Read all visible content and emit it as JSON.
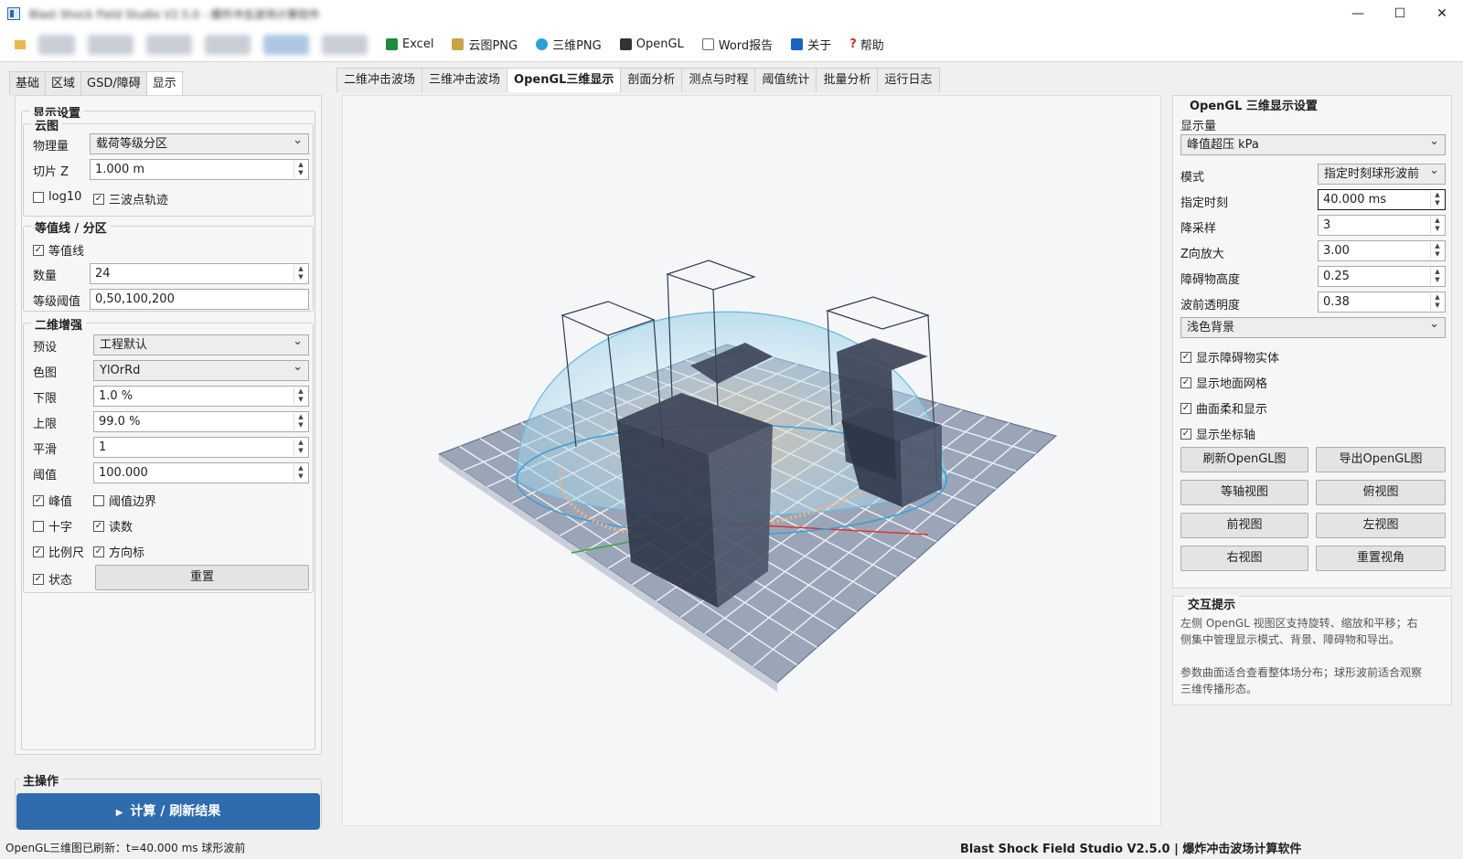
{
  "window": {
    "title": "Blast Shock Field Studio V2.5.0 - 爆炸冲击波场计算软件",
    "minimize": "—",
    "maximize": "☐",
    "close": "✕"
  },
  "toolbar": {
    "items": [
      "Excel",
      "云图PNG",
      "三维PNG",
      "OpenGL",
      "Word报告",
      "关于",
      "帮助"
    ]
  },
  "left_tabs": [
    "基础",
    "区域",
    "GSD/障碍",
    "显示"
  ],
  "display": {
    "title": "显示设置",
    "cloud": {
      "title": "云图",
      "quantity_label": "物理量",
      "quantity_value": "载荷等级分区",
      "slice_label": "切片 Z",
      "slice_value": "1.000 m",
      "log10": "log10",
      "track": "三波点轨迹"
    },
    "contour": {
      "title": "等值线 / 分区",
      "enable": "等值线",
      "count_label": "数量",
      "count_value": "24",
      "levels_label": "等级阈值",
      "levels_value": "0,50,100,200"
    },
    "enhance": {
      "title": "二维增强",
      "preset_label": "预设",
      "preset_value": "工程默认",
      "cmap_label": "色图",
      "cmap_value": "YlOrRd",
      "low_label": "下限",
      "low_value": "1.0 %",
      "high_label": "上限",
      "high_value": "99.0 %",
      "smooth_label": "平滑",
      "smooth_value": "1",
      "thresh_label": "阈值",
      "thresh_value": "100.000",
      "peak": "峰值",
      "thresh_edge": "阈值边界",
      "cross": "十字",
      "readout": "读数",
      "scalebar": "比例尺",
      "compass": "方向标",
      "status": "状态",
      "reset": "重置"
    }
  },
  "main_ops": {
    "title": "主操作",
    "compute": "计算 / 刷新结果"
  },
  "main_tabs": [
    "二维冲击波场",
    "三维冲击波场",
    "OpenGL三维显示",
    "剖面分析",
    "测点与时程",
    "阈值统计",
    "批量分析",
    "运行日志"
  ],
  "opengl": {
    "title": "OpenGL 三维显示设置",
    "qty_label": "显示量",
    "qty_value": "峰值超压 kPa",
    "mode_label": "模式",
    "mode_value": "指定时刻球形波前",
    "time_label": "指定时刻",
    "time_value": "40.000 ms",
    "down_label": "降采样",
    "down_value": "3",
    "zscale_label": "Z向放大",
    "zscale_value": "3.00",
    "obs_h_label": "障碍物高度",
    "obs_h_value": "0.25",
    "alpha_label": "波前透明度",
    "alpha_value": "0.38",
    "bg_value": "浅色背景",
    "chk_obstacle": "显示障碍物实体",
    "chk_grid": "显示地面网格",
    "chk_smooth": "曲面柔和显示",
    "chk_axes": "显示坐标轴",
    "btn_refresh": "刷新OpenGL图",
    "btn_export": "导出OpenGL图",
    "btn_iso": "等轴视图",
    "btn_top": "俯视图",
    "btn_front": "前视图",
    "btn_left": "左视图",
    "btn_right": "右视图",
    "btn_reset": "重置视角"
  },
  "hint": {
    "title": "交互提示",
    "line1": "左侧 OpenGL 视图区支持旋转、缩放和平移；右",
    "line2": "侧集中管理显示模式、背景、障碍物和导出。",
    "line3": "参数曲面适合查看整体场分布；球形波前适合观察",
    "line4": "三维传播形态。"
  },
  "status": {
    "left": "OpenGL三维图已刷新：t=40.000 ms 球形波前",
    "right": "Blast Shock Field Studio V2.5.0 | 爆炸冲击波场计算软件"
  }
}
